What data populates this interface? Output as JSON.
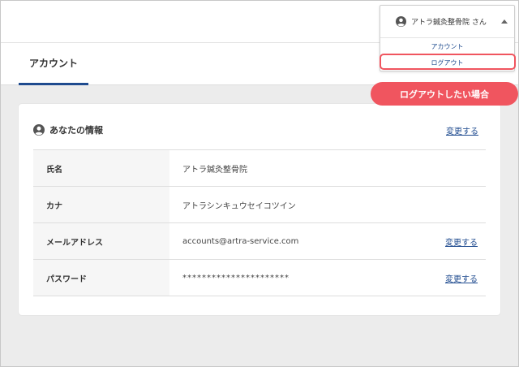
{
  "header": {
    "user_name": "アトラ鍼灸整骨院 さん",
    "menu_items": [
      "アカウント",
      "ログアウト"
    ]
  },
  "tabs": [
    {
      "label": "アカウント",
      "active": true
    }
  ],
  "card": {
    "title": "あなたの情報",
    "edit_label": "変更する",
    "rows": [
      {
        "label": "氏名",
        "value": "アトラ鍼灸整骨院",
        "editable": false
      },
      {
        "label": "カナ",
        "value": "アトラシンキュウセイコツイン",
        "editable": false
      },
      {
        "label": "メールアドレス",
        "value": "accounts@artra-service.com",
        "editable": true,
        "edit_label": "変更する"
      },
      {
        "label": "パスワード",
        "value": "**********************",
        "editable": true,
        "edit_label": "変更する"
      }
    ]
  },
  "annotation": {
    "callout_text": "ログアウトしたい場合",
    "highlight_color": "#f0555f"
  },
  "colors": {
    "accent": "#1f4b8f",
    "callout": "#f0555f",
    "background": "#ececec"
  },
  "icons": [
    "user-circle-icon",
    "caret-up-icon",
    "account-info-icon"
  ]
}
